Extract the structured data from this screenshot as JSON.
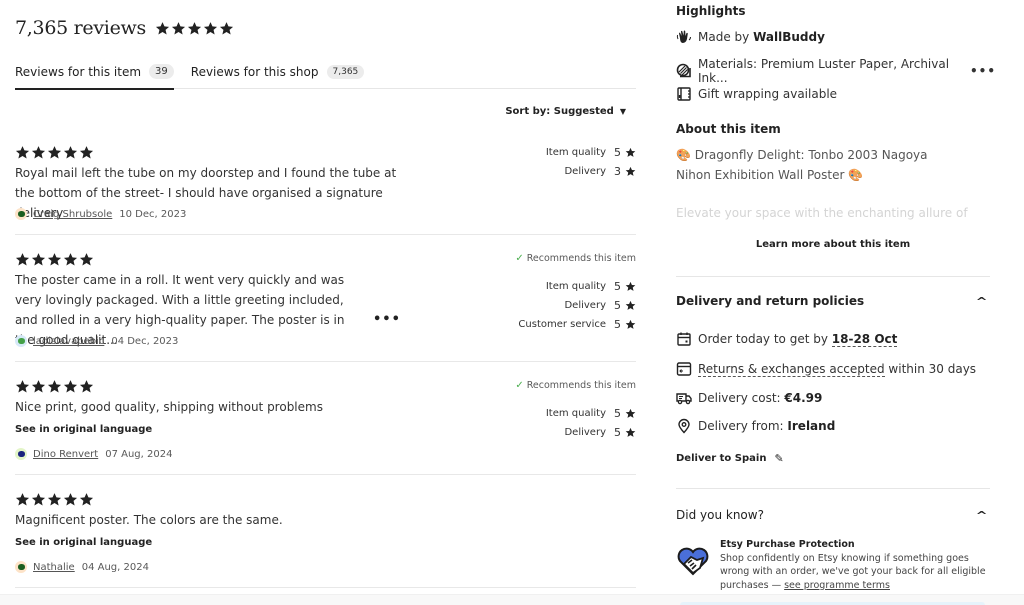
{
  "reviews_header": {
    "title": "7,365 reviews",
    "overall_rating": 5,
    "overall_rating_max": 5
  },
  "tabs": [
    {
      "label": "Reviews for this item",
      "count": "39",
      "active": true
    },
    {
      "label": "Reviews for this shop",
      "count": "7,365",
      "active": false
    }
  ],
  "sort": {
    "label": "Sort by: Suggested"
  },
  "reviews": [
    {
      "stars": 5,
      "text": "Royal mail left the tube on my doorstep and I found the tube at the bottom of the street- I should have organised a signature delivery",
      "author": "Craig Shrubsole",
      "date": "10 Dec, 2023",
      "avatar_bg": "#fde3c8",
      "avatar_fg": "#1b5e20",
      "recommends": null,
      "ratings": [
        {
          "label": "Item quality",
          "value": "5"
        },
        {
          "label": "Delivery",
          "value": "3"
        }
      ]
    },
    {
      "stars": 5,
      "text": "The poster came in a roll. It went very quickly and was very lovingly packaged. With a little greeting included, and rolled in a very high-quality paper. The poster is in the good qualit...",
      "author": "ladislavabebic",
      "date": "04 Dec, 2023",
      "avatar_bg": "#d6e9f8",
      "avatar_fg": "#43a047",
      "recommends": "Recommends this item",
      "ratings": [
        {
          "label": "Item quality",
          "value": "5"
        },
        {
          "label": "Delivery",
          "value": "5"
        },
        {
          "label": "Customer service",
          "value": "5"
        }
      ]
    },
    {
      "stars": 5,
      "text": "Nice print, good quality, shipping without problems",
      "see_original": "See in original language",
      "author": "Dino Renvert",
      "date": "07 Aug, 2024",
      "avatar_bg": "#e3f5c8",
      "avatar_fg": "#1a237e",
      "recommends": "Recommends this item",
      "ratings": [
        {
          "label": "Item quality",
          "value": "5"
        },
        {
          "label": "Delivery",
          "value": "5"
        }
      ]
    },
    {
      "stars": 5,
      "text": "Magnificent poster. The colors are the same.",
      "see_original": "See in original language",
      "author": "Nathalie",
      "date": "04 Aug, 2024",
      "avatar_bg": "#fde3c8",
      "avatar_fg": "#1b5e20",
      "recommends": null,
      "ratings": []
    }
  ],
  "highlights": {
    "title": "Highlights",
    "made_by_prefix": "Made by ",
    "made_by_shop": "WallBuddy",
    "materials": "Materials: Premium Luster Paper, Archival Ink...",
    "gift_wrap": "Gift wrapping available"
  },
  "about": {
    "title": "About this item",
    "headline": "🎨 Dragonfly Delight: Tonbo 2003 Nagoya Nihon Exhibition Wall Poster 🎨",
    "faded_text": "Elevate your space with the enchanting allure of",
    "learn_more": "Learn more about this item"
  },
  "delivery": {
    "title": "Delivery and return policies",
    "order_prefix": "Order today to get by ",
    "order_dates": "18-28 Oct",
    "returns_link": "Returns & exchanges accepted",
    "returns_suffix": " within 30 days",
    "cost_prefix": "Delivery cost: ",
    "cost_value": "€4.99",
    "from_prefix": "Delivery from: ",
    "from_value": "Ireland",
    "deliver_to": "Deliver to Spain"
  },
  "did_you_know": {
    "title": "Did you know?",
    "protection_title": "Etsy Purchase Protection",
    "protection_text": "Shop confidently on Etsy knowing if something goes wrong with an order, we've got your back for all eligible purchases — ",
    "protection_link": "see programme terms"
  },
  "colors": {
    "text": "#222222",
    "muted": "#595959",
    "check_green": "#4caf50",
    "handshake_blue": "#4a6fd9"
  }
}
